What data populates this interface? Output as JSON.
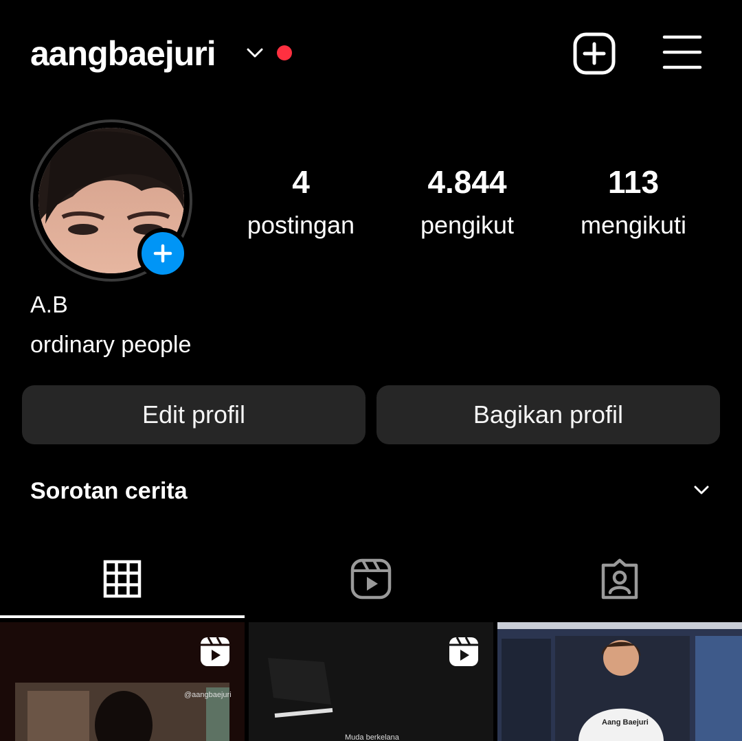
{
  "header": {
    "username": "aangbaejuri",
    "icons": [
      "chevron-down-icon",
      "notification-dot",
      "new-post-icon",
      "menu-icon"
    ],
    "notification_color": "#ff3040"
  },
  "profile": {
    "add_story_color": "#0095f6",
    "stats": [
      {
        "value": "4",
        "label": "postingan"
      },
      {
        "value": "4.844",
        "label": "pengikut"
      },
      {
        "value": "113",
        "label": "mengikuti"
      }
    ],
    "full_name": "A.B",
    "bio": "ordinary people"
  },
  "actions": {
    "edit_label": "Edit profil",
    "share_label": "Bagikan profil"
  },
  "highlights": {
    "label": "Sorotan cerita"
  },
  "tabs": [
    {
      "icon": "grid-icon",
      "active": true
    },
    {
      "icon": "reels-icon",
      "active": false
    },
    {
      "icon": "tagged-icon",
      "active": false
    }
  ],
  "posts": [
    {
      "type": "reel",
      "caption": "@aangbaejuri"
    },
    {
      "type": "reel",
      "caption": "Muda berkelana"
    },
    {
      "type": "image",
      "caption": "Aang Baejuri"
    }
  ]
}
